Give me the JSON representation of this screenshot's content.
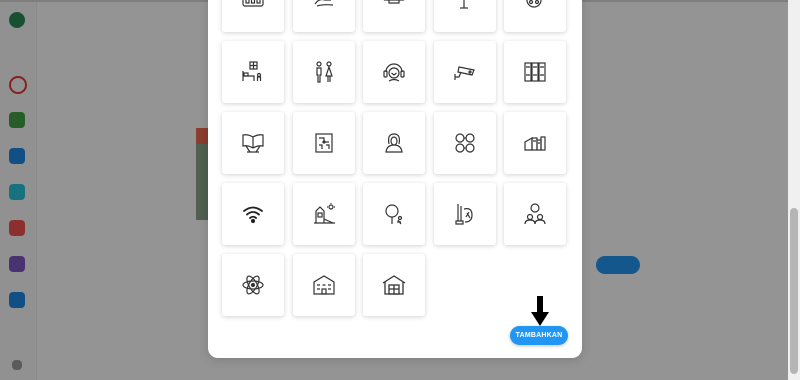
{
  "colors": {
    "accent": "#2196f3",
    "overlay": "rgba(0,0,0,0.42)",
    "icon_stroke": "#333333"
  },
  "modal": {
    "add_button_label": "TAMBAHKAN",
    "icons": [
      "classroom-icon",
      "hand-wash-icon",
      "ceiling-lamp-icon",
      "eagle-icon",
      "film-reel-icon",
      "bedroom-icon",
      "restroom-icon",
      "headset-support-icon",
      "cctv-camera-icon",
      "lockers-icon",
      "quran-stand-icon",
      "circuit-board-icon",
      "hijab-woman-icon",
      "currency-exchange-icon",
      "library-books-icon",
      "wifi-icon",
      "playground-icon",
      "table-tennis-icon",
      "art-tools-icon",
      "discussion-icon",
      "atom-icon",
      "school-building-icon",
      "warehouse-icon"
    ]
  },
  "background": {
    "sidebar_icons": [
      "app-logo-icon",
      "notification-icon",
      "home-icon",
      "calendar-icon",
      "chat-icon",
      "bookmark-icon",
      "profile-icon",
      "settings-icon",
      "help-icon"
    ]
  }
}
